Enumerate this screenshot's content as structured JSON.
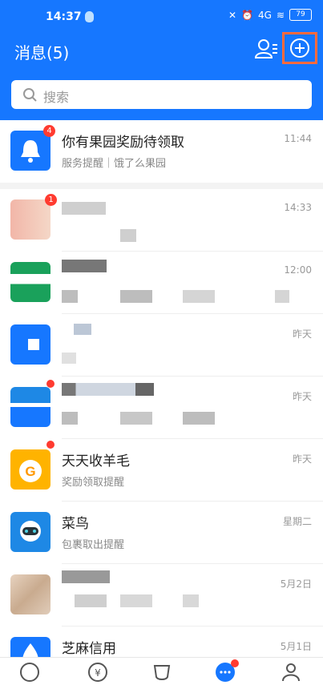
{
  "status_bar": {
    "time": "14:37",
    "network": "4G",
    "battery": "79"
  },
  "header": {
    "title": "消息(5)"
  },
  "search": {
    "placeholder": "搜索"
  },
  "messages": [
    {
      "name": "你有果园奖励待领取",
      "preview": "服务提醒｜饿了么果园",
      "time": "11:44",
      "badge": "4"
    },
    {
      "name": "",
      "preview": "",
      "time": "14:33",
      "badge": "1"
    },
    {
      "name": "",
      "preview": "",
      "time": "12:00"
    },
    {
      "name": "",
      "preview": "",
      "time": "昨天"
    },
    {
      "name": "",
      "preview": "",
      "time": "昨天"
    },
    {
      "name": "天天收羊毛",
      "preview": "奖励领取提醒",
      "time": "昨天"
    },
    {
      "name": "菜鸟",
      "preview": "包裹取出提醒",
      "time": "星期二"
    },
    {
      "name": "",
      "preview": "",
      "time": "5月2日"
    },
    {
      "name": "芝麻信用",
      "preview": "",
      "time": "5月1日"
    }
  ],
  "colors": {
    "brand": "#1677ff",
    "highlight": "#ff6a3d",
    "badge": "#ff3b30"
  }
}
